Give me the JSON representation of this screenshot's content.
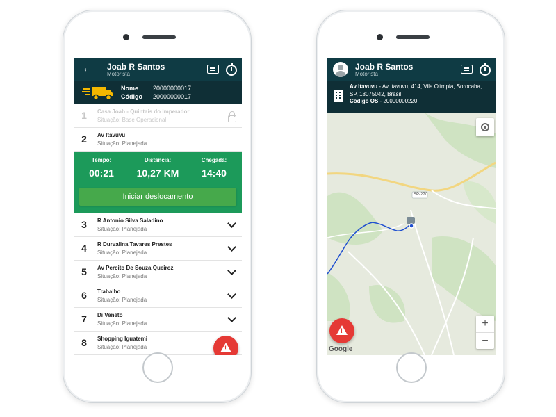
{
  "left_app": {
    "header": {
      "driver_name": "Joab R Santos",
      "driver_role": "Motorista"
    },
    "vehicle": {
      "name_label": "Nome",
      "name_value": "20000000017",
      "code_label": "Código",
      "code_value": "20000000017"
    },
    "stops": [
      {
        "number": "1",
        "name": "Casa Joab - Quintais do Imperador",
        "status": "Situação: Base Operacional",
        "state": "locked"
      },
      {
        "number": "2",
        "name": "Av Itavuvu",
        "status": "Situação: Planejada",
        "state": "active"
      },
      {
        "number": "3",
        "name": "R Antonio Silva Saladino",
        "status": "Situação: Planejada",
        "state": "collapsed"
      },
      {
        "number": "4",
        "name": "R Durvalina Tavares Prestes",
        "status": "Situação: Planejada",
        "state": "collapsed"
      },
      {
        "number": "5",
        "name": "Av Percito De Souza Queiroz",
        "status": "Situação: Planejada",
        "state": "collapsed"
      },
      {
        "number": "6",
        "name": "Trabalho",
        "status": "Situação: Planejada",
        "state": "collapsed"
      },
      {
        "number": "7",
        "name": "Di Veneto",
        "status": "Situação: Planejada",
        "state": "collapsed"
      },
      {
        "number": "8",
        "name": "Shopping Iguatemi",
        "status": "Situação: Planejada",
        "state": "collapsed"
      }
    ],
    "trip": {
      "time_label": "Tempo:",
      "time_value": "00:21",
      "distance_label": "Distância:",
      "distance_value": "10,27 KM",
      "arrival_label": "Chegada:",
      "arrival_value": "14:40",
      "start_button": "Iniciar deslocamento"
    }
  },
  "right_app": {
    "header": {
      "driver_name": "Joab R Santos",
      "driver_role": "Motorista"
    },
    "destination": {
      "name": "Av Itavuvu",
      "address": " - Av Itavuvu, 414, Vila Olímpia, Sorocaba, SP, 18075042, Brasil",
      "os_label": "Código OS",
      "os_value": " - 20000000220"
    },
    "map": {
      "road_label": "SP-270",
      "zoom_in": "+",
      "zoom_out": "−",
      "attribution": "Google"
    }
  },
  "colors": {
    "header_bg": "#0f3b44",
    "subheader_bg": "#0f2f36",
    "trip_panel": "#1c9a5a",
    "start_button": "#46a94b",
    "alert_fab": "#e53935",
    "truck": "#f5b800",
    "route": "#1f4fd0"
  }
}
